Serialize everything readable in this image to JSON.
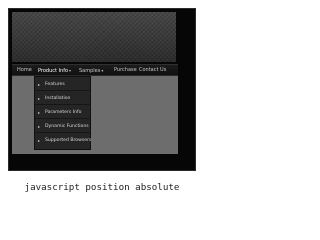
{
  "menu": {
    "items": [
      {
        "label": "Home"
      },
      {
        "label": "Product Info",
        "has_submenu": true
      },
      {
        "label": "Samples",
        "has_submenu": true
      },
      {
        "label": "Purchase"
      },
      {
        "label": "Contact Us"
      }
    ],
    "dropdown": [
      {
        "label": "Features"
      },
      {
        "label": "Installation"
      },
      {
        "label": "Parameters Info"
      },
      {
        "label": "Dynamic Functions"
      },
      {
        "label": "Supported Browsers"
      }
    ],
    "arrow_icon": "▾",
    "bullet_icon": "▸"
  },
  "caption": "javascript position absolute",
  "colors": {
    "frame": "#060606",
    "menubar": "#141414",
    "content": "#6d6d6d",
    "dropdown": "#252525"
  }
}
